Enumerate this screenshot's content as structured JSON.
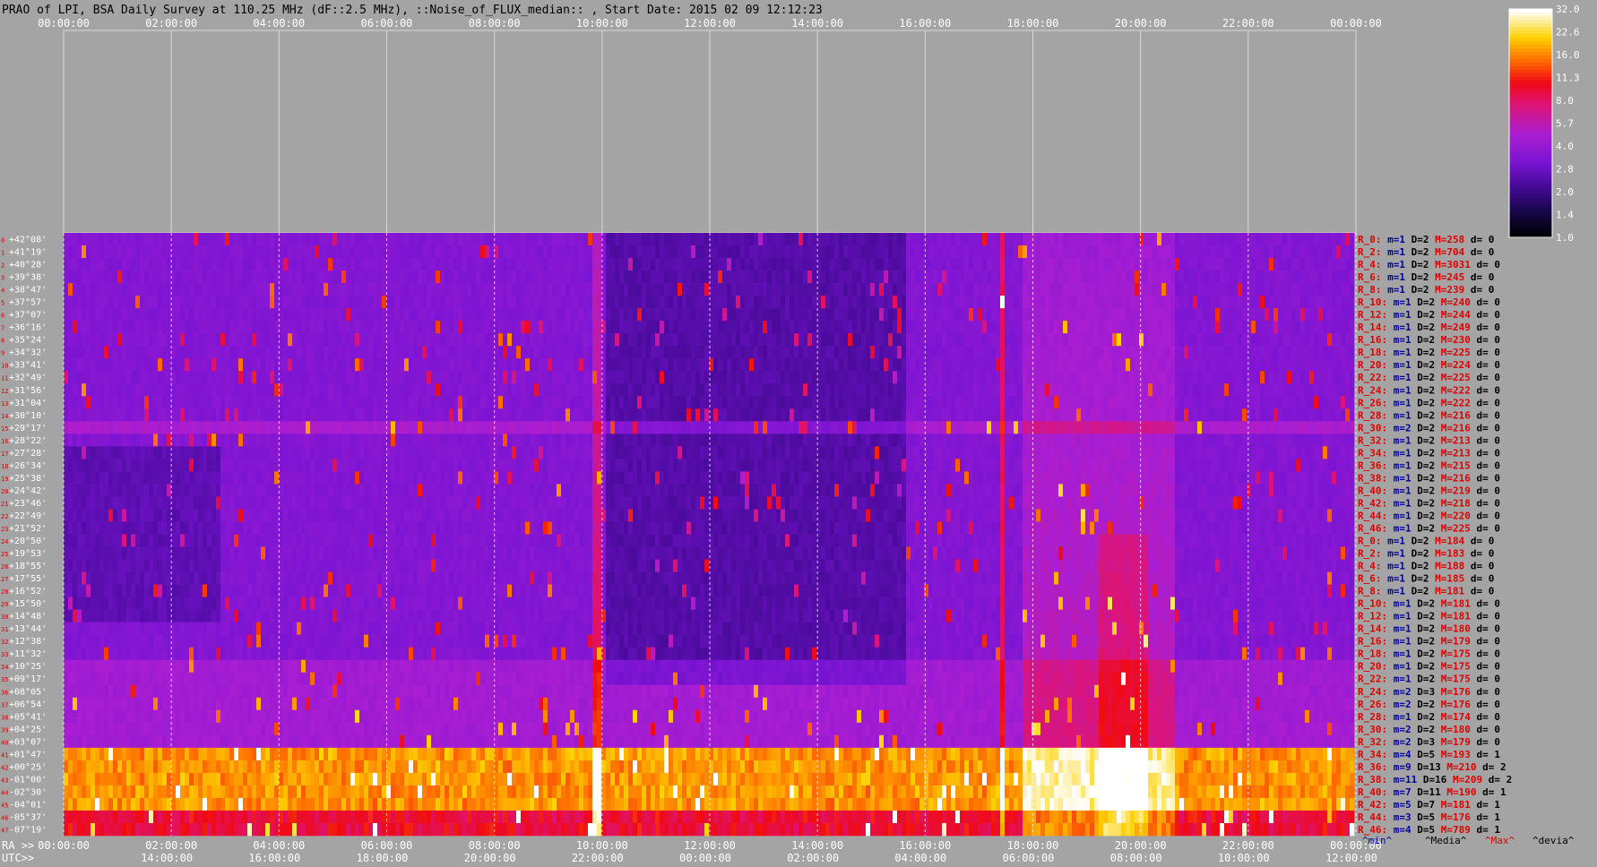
{
  "title": "PRAO of LPI, BSA Daily Survey at 110.25 MHz (dF::2.5 MHz), ::Noise_of_FLUX_median:: , Start Date: 2015 02 09 12:12:23",
  "chart_data": {
    "type": "heatmap",
    "title": "PRAO of LPI, BSA Daily Survey at 110.25 MHz (dF::2.5 MHz), ::Noise_of_FLUX_median:: , Start Date: 2015 02 09 12:12:23",
    "x_ticks_top": [
      "00:00:00",
      "02:00:00",
      "04:00:00",
      "06:00:00",
      "08:00:00",
      "10:00:00",
      "12:00:00",
      "14:00:00",
      "16:00:00",
      "18:00:00",
      "20:00:00",
      "22:00:00",
      "00:00:00"
    ],
    "x_ticks_ra": [
      "00:00:00",
      "02:00:00",
      "04:00:00",
      "06:00:00",
      "08:00:00",
      "10:00:00",
      "12:00:00",
      "14:00:00",
      "16:00:00",
      "18:00:00",
      "20:00:00",
      "22:00:00",
      "00:00:00"
    ],
    "x_ticks_utc": [
      "14:00:00",
      "16:00:00",
      "18:00:00",
      "20:00:00",
      "22:00:00",
      "00:00:00",
      "02:00:00",
      "04:00:00",
      "06:00:00",
      "08:00:00",
      "10:00:00",
      "12:00:00"
    ],
    "ra_label": "RA >>",
    "utc_label": "UTC>>",
    "declinations": [
      "+42°08'",
      "+41°19'",
      "+40°28'",
      "+39°38'",
      "+38°47'",
      "+37°57'",
      "+37°07'",
      "+36°16'",
      "+35°24'",
      "+34°32'",
      "+33°41'",
      "+32°49'",
      "+31°56'",
      "+31°04'",
      "+30°10'",
      "+29°17'",
      "+28°22'",
      "+27°28'",
      "+26°34'",
      "+25°38'",
      "+24°42'",
      "+23°46'",
      "+22°49'",
      "+21°52'",
      "+20°50'",
      "+19°53'",
      "+18°55'",
      "+17°55'",
      "+16°52'",
      "+15°50'",
      "+14°48'",
      "+13°44'",
      "+12°38'",
      "+11°32'",
      "+10°25'",
      "+09°17'",
      "+08°05'",
      "+06°54'",
      "+05°41'",
      "+04°25'",
      "+03°07'",
      "+01°47'",
      "+00°25'",
      "-01°00'",
      "-02°30'",
      "-04°01'",
      "-05°37'",
      "-07°19'"
    ],
    "row_stats": [
      {
        "r": "R_0:",
        "m": "m=1",
        "D": "D=2",
        "M": "M=258",
        "d": "d= 0"
      },
      {
        "r": "R_2:",
        "m": "m=1",
        "D": "D=2",
        "M": "M=704",
        "d": "d= 0"
      },
      {
        "r": "R_4:",
        "m": "m=1",
        "D": "D=2",
        "M": "M=3031",
        "d": "d= 0"
      },
      {
        "r": "R_6:",
        "m": "m=1",
        "D": "D=2",
        "M": "M=245",
        "d": "d= 0"
      },
      {
        "r": "R_8:",
        "m": "m=1",
        "D": "D=2",
        "M": "M=239",
        "d": "d= 0"
      },
      {
        "r": "R_10:",
        "m": "m=1",
        "D": "D=2",
        "M": "M=240",
        "d": "d= 0"
      },
      {
        "r": "R_12:",
        "m": "m=1",
        "D": "D=2",
        "M": "M=244",
        "d": "d= 0"
      },
      {
        "r": "R_14:",
        "m": "m=1",
        "D": "D=2",
        "M": "M=249",
        "d": "d= 0"
      },
      {
        "r": "R_16:",
        "m": "m=1",
        "D": "D=2",
        "M": "M=230",
        "d": "d= 0"
      },
      {
        "r": "R_18:",
        "m": "m=1",
        "D": "D=2",
        "M": "M=225",
        "d": "d= 0"
      },
      {
        "r": "R_20:",
        "m": "m=1",
        "D": "D=2",
        "M": "M=224",
        "d": "d= 0"
      },
      {
        "r": "R_22:",
        "m": "m=1",
        "D": "D=2",
        "M": "M=225",
        "d": "d= 0"
      },
      {
        "r": "R_24:",
        "m": "m=1",
        "D": "D=2",
        "M": "M=222",
        "d": "d= 0"
      },
      {
        "r": "R_26:",
        "m": "m=1",
        "D": "D=2",
        "M": "M=222",
        "d": "d= 0"
      },
      {
        "r": "R_28:",
        "m": "m=1",
        "D": "D=2",
        "M": "M=216",
        "d": "d= 0"
      },
      {
        "r": "R_30:",
        "m": "m=2",
        "D": "D=2",
        "M": "M=216",
        "d": "d= 0"
      },
      {
        "r": "R_32:",
        "m": "m=1",
        "D": "D=2",
        "M": "M=213",
        "d": "d= 0"
      },
      {
        "r": "R_34:",
        "m": "m=1",
        "D": "D=2",
        "M": "M=213",
        "d": "d= 0"
      },
      {
        "r": "R_36:",
        "m": "m=1",
        "D": "D=2",
        "M": "M=215",
        "d": "d= 0"
      },
      {
        "r": "R_38:",
        "m": "m=1",
        "D": "D=2",
        "M": "M=216",
        "d": "d= 0"
      },
      {
        "r": "R_40:",
        "m": "m=1",
        "D": "D=2",
        "M": "M=219",
        "d": "d= 0"
      },
      {
        "r": "R_42:",
        "m": "m=1",
        "D": "D=2",
        "M": "M=218",
        "d": "d= 0"
      },
      {
        "r": "R_44:",
        "m": "m=1",
        "D": "D=2",
        "M": "M=220",
        "d": "d= 0"
      },
      {
        "r": "R_46:",
        "m": "m=1",
        "D": "D=2",
        "M": "M=225",
        "d": "d= 0"
      },
      {
        "r": "R_0:",
        "m": "m=1",
        "D": "D=2",
        "M": "M=184",
        "d": "d= 0"
      },
      {
        "r": "R_2:",
        "m": "m=1",
        "D": "D=2",
        "M": "M=183",
        "d": "d= 0"
      },
      {
        "r": "R_4:",
        "m": "m=1",
        "D": "D=2",
        "M": "M=188",
        "d": "d= 0"
      },
      {
        "r": "R_6:",
        "m": "m=1",
        "D": "D=2",
        "M": "M=185",
        "d": "d= 0"
      },
      {
        "r": "R_8:",
        "m": "m=1",
        "D": "D=2",
        "M": "M=181",
        "d": "d= 0"
      },
      {
        "r": "R_10:",
        "m": "m=1",
        "D": "D=2",
        "M": "M=181",
        "d": "d= 0"
      },
      {
        "r": "R_12:",
        "m": "m=1",
        "D": "D=2",
        "M": "M=181",
        "d": "d= 0"
      },
      {
        "r": "R_14:",
        "m": "m=1",
        "D": "D=2",
        "M": "M=180",
        "d": "d= 0"
      },
      {
        "r": "R_16:",
        "m": "m=1",
        "D": "D=2",
        "M": "M=179",
        "d": "d= 0"
      },
      {
        "r": "R_18:",
        "m": "m=1",
        "D": "D=2",
        "M": "M=175",
        "d": "d= 0"
      },
      {
        "r": "R_20:",
        "m": "m=1",
        "D": "D=2",
        "M": "M=175",
        "d": "d= 0"
      },
      {
        "r": "R_22:",
        "m": "m=1",
        "D": "D=2",
        "M": "M=175",
        "d": "d= 0"
      },
      {
        "r": "R_24:",
        "m": "m=2",
        "D": "D=3",
        "M": "M=176",
        "d": "d= 0"
      },
      {
        "r": "R_26:",
        "m": "m=2",
        "D": "D=2",
        "M": "M=176",
        "d": "d= 0"
      },
      {
        "r": "R_28:",
        "m": "m=1",
        "D": "D=2",
        "M": "M=174",
        "d": "d= 0"
      },
      {
        "r": "R_30:",
        "m": "m=2",
        "D": "D=2",
        "M": "M=180",
        "d": "d= 0"
      },
      {
        "r": "R_32:",
        "m": "m=2",
        "D": "D=3",
        "M": "M=179",
        "d": "d= 0"
      },
      {
        "r": "R_34:",
        "m": "m=4",
        "D": "D=5",
        "M": "M=193",
        "d": "d= 1"
      },
      {
        "r": "R_36:",
        "m": "m=9",
        "D": "D=13",
        "M": "M=210",
        "d": "d= 2"
      },
      {
        "r": "R_38:",
        "m": "m=11",
        "D": "D=16",
        "M": "M=209",
        "d": "d= 2"
      },
      {
        "r": "R_40:",
        "m": "m=7",
        "D": "D=11",
        "M": "M=190",
        "d": "d= 1"
      },
      {
        "r": "R_42:",
        "m": "m=5",
        "D": "D=7",
        "M": "M=181",
        "d": "d= 1"
      },
      {
        "r": "R_44:",
        "m": "m=3",
        "D": "D=5",
        "M": "M=176",
        "d": "d= 1"
      },
      {
        "r": "R_46:",
        "m": "m=4",
        "D": "D=5",
        "M": "M=789",
        "d": "d= 1"
      }
    ],
    "stats_legend": {
      "min": "^min^",
      "median": "^Media^",
      "max": "^Max^",
      "devia": "^devia^"
    },
    "colorbar": {
      "ticks": [
        "32.0",
        "22.6",
        "16.0",
        "11.3",
        "8.0",
        "5.7",
        "4.0",
        "2.8",
        "2.0",
        "1.4",
        "1.0"
      ],
      "range": [
        1.0,
        32.0
      ],
      "scale": "log"
    },
    "colors": {
      "background": "#a4a4a4",
      "stat_label": "#e00000",
      "stat_m": "#0000a0",
      "stat_D": "#000000",
      "stat_M": "#e00000",
      "stat_d": "#000000",
      "axis_text": "#ffffff",
      "title_text": "#000000"
    }
  }
}
